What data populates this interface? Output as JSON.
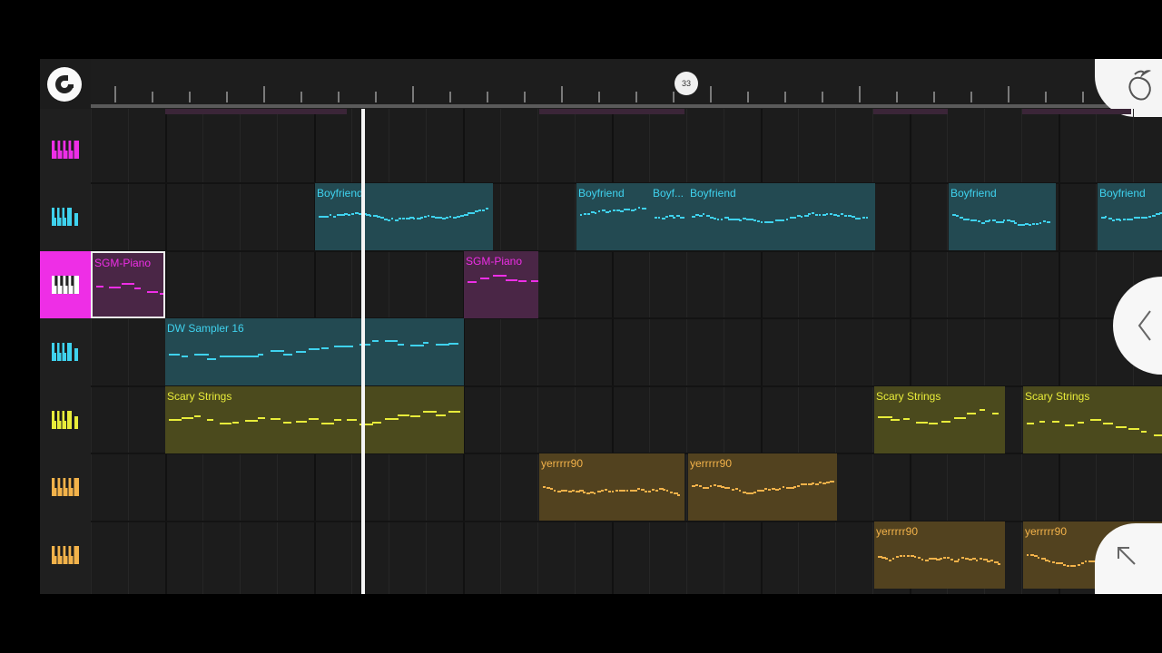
{
  "timeline": {
    "bar_marker": "33"
  },
  "colors": {
    "pink": "#ee2ee6",
    "cyan": "#3fd2ee",
    "yellow": "#e8ec3a",
    "orange": "#f2b24a"
  },
  "tracks": [
    {
      "id": "track-1",
      "color": "pink",
      "active": false
    },
    {
      "id": "track-2",
      "color": "cyan",
      "active": false
    },
    {
      "id": "track-3",
      "color": "pink",
      "active": true
    },
    {
      "id": "track-4",
      "color": "cyan",
      "active": false
    },
    {
      "id": "track-5",
      "color": "yellow",
      "active": false
    },
    {
      "id": "track-6",
      "color": "orange",
      "active": false
    },
    {
      "id": "track-7",
      "color": "orange",
      "active": false
    }
  ],
  "clips": [
    {
      "label": "Boyfriend",
      "track": 1,
      "color": "cyan"
    },
    {
      "label": "Boyfriend",
      "track": 1,
      "color": "cyan"
    },
    {
      "label": "Boyf...",
      "track": 1,
      "color": "cyan"
    },
    {
      "label": "Boyfriend",
      "track": 1,
      "color": "cyan"
    },
    {
      "label": "Boyfriend",
      "track": 1,
      "color": "cyan"
    },
    {
      "label": "Boyfriend",
      "track": 1,
      "color": "cyan"
    },
    {
      "label": "SGM-Piano",
      "track": 2,
      "color": "pink",
      "selected": true
    },
    {
      "label": "SGM-Piano",
      "track": 2,
      "color": "pink"
    },
    {
      "label": "DW Sampler 16",
      "track": 3,
      "color": "cyan"
    },
    {
      "label": "Scary Strings",
      "track": 4,
      "color": "yellow"
    },
    {
      "label": "Scary Strings",
      "track": 4,
      "color": "yellow"
    },
    {
      "label": "Scary Strings",
      "track": 4,
      "color": "yellow"
    },
    {
      "label": "yerrrrr90",
      "track": 5,
      "color": "orange"
    },
    {
      "label": "yerrrrr90",
      "track": 5,
      "color": "orange"
    },
    {
      "label": "yerrrrr90",
      "track": 6,
      "color": "orange"
    },
    {
      "label": "yerrrrr90",
      "track": 6,
      "color": "orange"
    }
  ],
  "icons": {
    "magnet": "magnet-icon",
    "logo": "fl-fruit-logo-icon",
    "collapse": "chevron-left-icon",
    "expand": "arrow-up-left-icon"
  }
}
